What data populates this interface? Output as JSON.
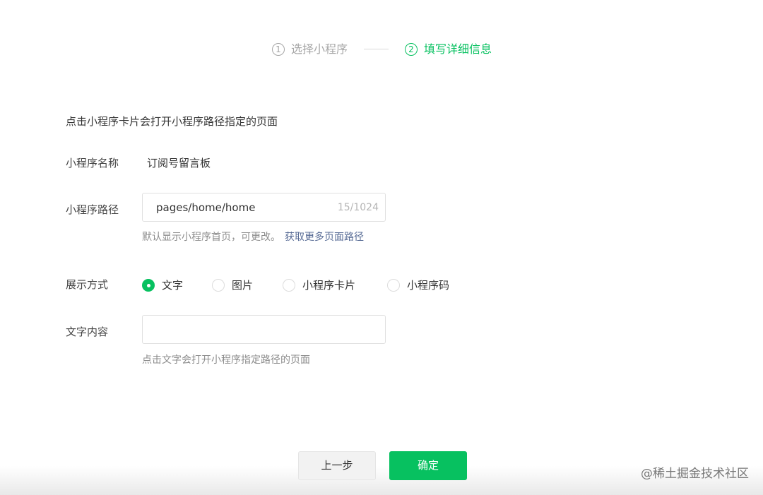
{
  "steps": [
    {
      "number": "1",
      "label": "选择小程序",
      "state": "done"
    },
    {
      "number": "2",
      "label": "填写详细信息",
      "state": "active"
    }
  ],
  "colors": {
    "primary": "#07c160",
    "link": "#576b95",
    "muted": "#8c8c8c"
  },
  "form": {
    "intro": "点击小程序卡片会打开小程序路径指定的页面",
    "name_label": "小程序名称",
    "name_value": "订阅号留言板",
    "path_label": "小程序路径",
    "path_value": "pages/home/home",
    "path_counter": "15/1024",
    "path_help": "默认显示小程序首页，可更改。",
    "path_help_link": "获取更多页面路径",
    "mode_label": "展示方式",
    "modes": [
      {
        "label": "文字",
        "checked": true
      },
      {
        "label": "图片",
        "checked": false
      },
      {
        "label": "小程序卡片",
        "checked": false
      },
      {
        "label": "小程序码",
        "checked": false
      }
    ],
    "text_label": "文字内容",
    "text_value": "",
    "text_help": "点击文字会打开小程序指定路径的页面"
  },
  "buttons": {
    "prev": "上一步",
    "confirm": "确定"
  },
  "watermark": "@稀土掘金技术社区"
}
